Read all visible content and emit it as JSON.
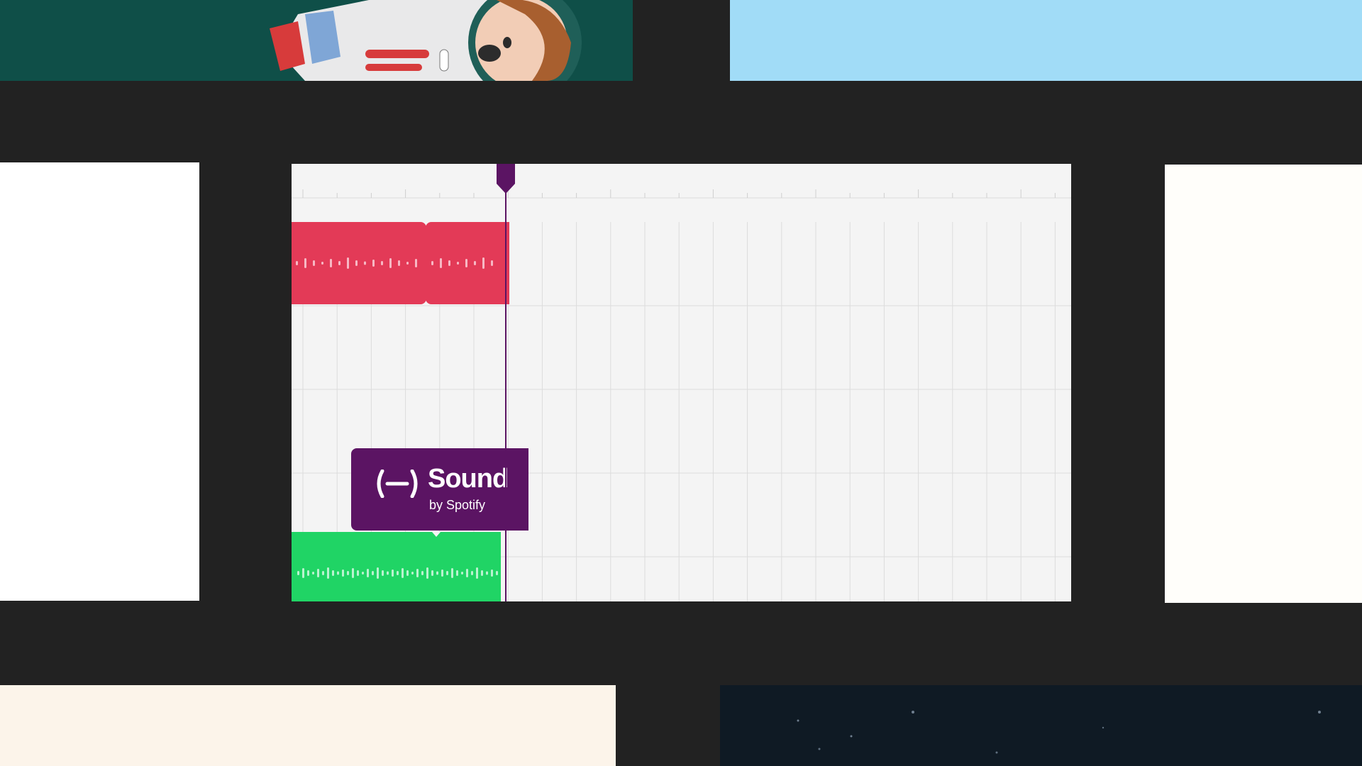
{
  "timeline": {
    "logo_clip": {
      "wordmark": "Sound",
      "byline": "by Spotify"
    }
  },
  "colors": {
    "background": "#222222",
    "timeline_bg": "#f4f4f4",
    "grid_line": "#dcdcdc",
    "red_clip": "#e33a57",
    "green_clip": "#20d465",
    "purple_clip": "#5b1463",
    "playhead": "#5b1463"
  },
  "icons": {
    "logo_mark": "bracket-dash-logo-icon",
    "playhead": "playhead-marker-icon"
  }
}
